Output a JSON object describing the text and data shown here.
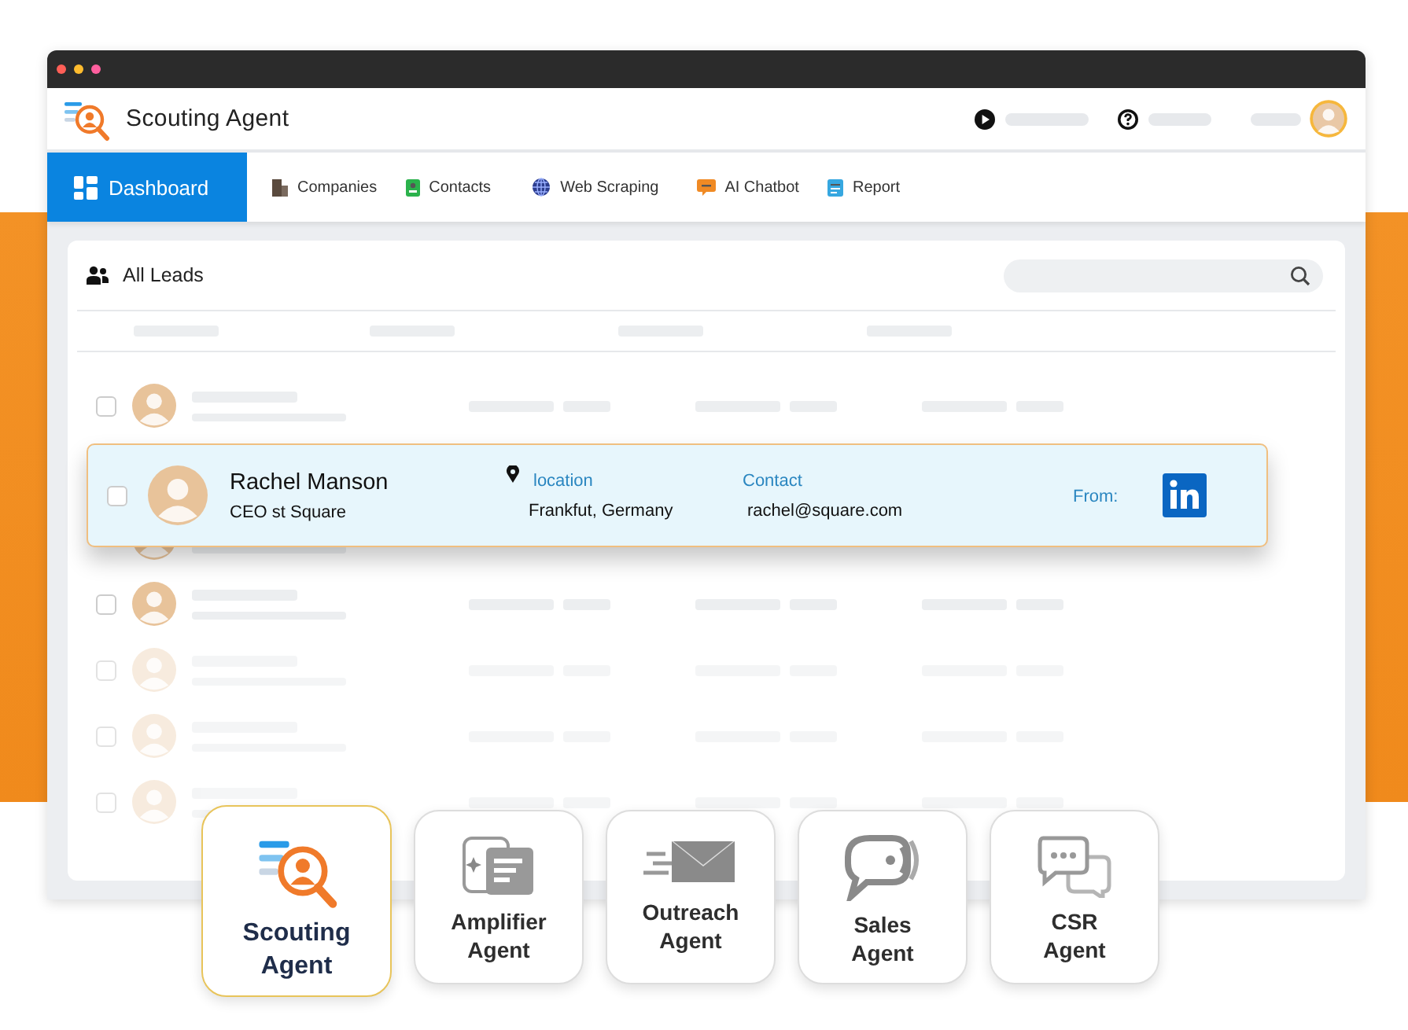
{
  "app": {
    "title": "Scouting Agent"
  },
  "nav": [
    {
      "label": "Dashboard",
      "selected": true
    },
    {
      "label": "Companies",
      "selected": false
    },
    {
      "label": "Contacts",
      "selected": false
    },
    {
      "label": "Web Scraping",
      "selected": false
    },
    {
      "label": "AI Chatbot",
      "selected": false
    },
    {
      "label": "Report",
      "selected": false
    }
  ],
  "leads": {
    "title": "All Leads",
    "rows": [
      {
        "checked": false
      },
      {
        "checked": false
      },
      {
        "checked": false
      },
      {
        "checked": false
      },
      {
        "checked": false
      }
    ],
    "featured": {
      "name": "Rachel Manson",
      "role": "CEO st Square",
      "checked": false,
      "location_label": "location",
      "location": "Frankfut, Germany",
      "contact_label": "Contact",
      "email": "rachel@square.com",
      "source_label": "From:"
    }
  },
  "agents": [
    {
      "label": "Scouting Agent",
      "selected": true
    },
    {
      "label": "Amplifier Agent",
      "selected": false
    },
    {
      "label": "Outreach Agent",
      "selected": false
    },
    {
      "label": "Sales Agent",
      "selected": false
    },
    {
      "label": "CSR Agent",
      "selected": false
    }
  ]
}
